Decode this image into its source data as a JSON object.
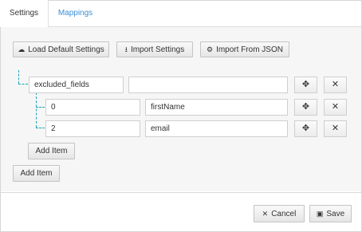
{
  "tabs": [
    {
      "label": "Settings"
    },
    {
      "label": "Mappings"
    }
  ],
  "toolbar": {
    "load_default": "Load Default Settings",
    "import_settings": "Import Settings",
    "import_json": "Import From JSON"
  },
  "tree": {
    "root_key": "excluded_fields",
    "root_value": "",
    "items": [
      {
        "index": "0",
        "value": "firstName"
      },
      {
        "index": "2",
        "value": "email"
      }
    ],
    "move_glyph": "✥",
    "remove_glyph": "✕",
    "add_item_inner": "Add Item",
    "add_item_outer": "Add Item"
  },
  "footer": {
    "cancel_label": "Cancel",
    "save_label": "Save"
  },
  "colors": {
    "tab_link": "#3b8ed4",
    "tree_line": "#18a6b5"
  }
}
